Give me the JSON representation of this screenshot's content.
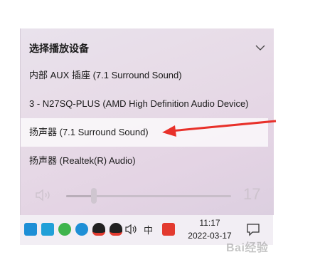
{
  "panel": {
    "title": "选择播放设备",
    "devices": [
      {
        "label": "内部 AUX 插座 (7.1 Surround Sound)"
      },
      {
        "label": "3 - N27SQ-PLUS (AMD High Definition Audio Device)"
      },
      {
        "label": "扬声器 (7.1 Surround Sound)",
        "selected": true
      },
      {
        "label": "扬声器 (Realtek(R) Audio)"
      }
    ],
    "volume": {
      "value": "17",
      "level": 0.17
    }
  },
  "taskbar": {
    "ime_label": "中",
    "clock_time": "11:17",
    "clock_date": "2022-03-17"
  },
  "watermark": "Bai经验",
  "colors": {
    "arrow": "#e8302a",
    "qq_red": "#e33a2f",
    "wechat_green": "#3fb44c",
    "app_blue": "#1e8fd6"
  }
}
